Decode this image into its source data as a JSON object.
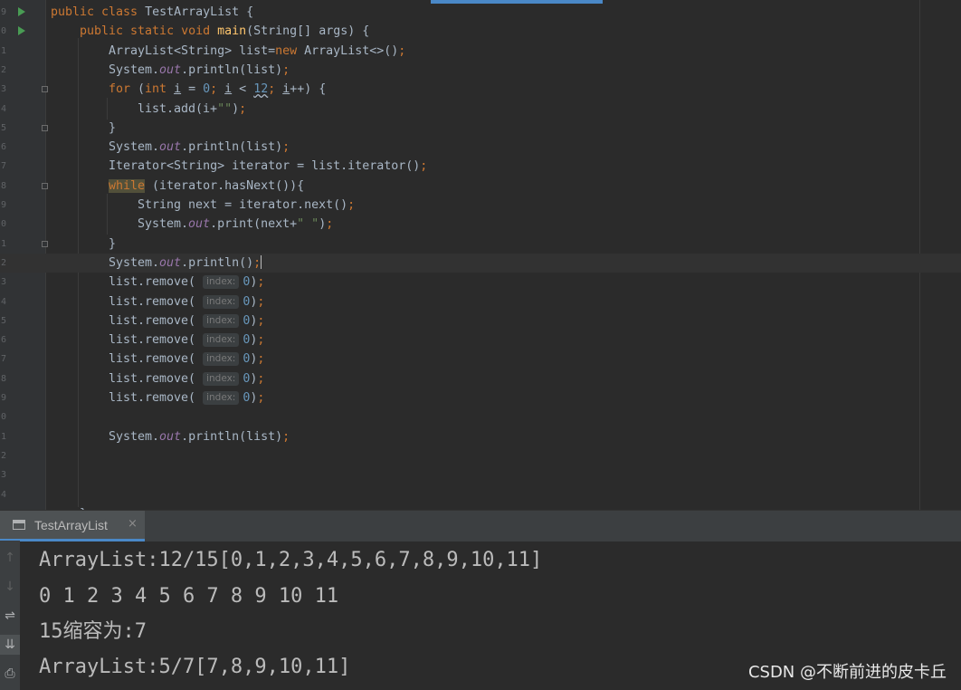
{
  "editor": {
    "lines": [
      {
        "num": "9",
        "run": true,
        "fold": false,
        "indent": 0,
        "current": false,
        "tokens": [
          {
            "t": "public class ",
            "c": "kw"
          },
          {
            "t": "TestArrayList {"
          }
        ]
      },
      {
        "num": "0",
        "run": true,
        "fold": false,
        "indent": 1,
        "current": false,
        "tokens": [
          {
            "t": "public static void ",
            "c": "kw"
          },
          {
            "t": "main",
            "c": "fn"
          },
          {
            "t": "(String[] args) {"
          }
        ]
      },
      {
        "num": "1",
        "run": false,
        "fold": false,
        "indent": 2,
        "current": false,
        "tokens": [
          {
            "t": "ArrayList<String> list="
          },
          {
            "t": "new ",
            "c": "kw"
          },
          {
            "t": "ArrayList<>()"
          },
          {
            "t": ";",
            "c": "kw"
          }
        ]
      },
      {
        "num": "2",
        "run": false,
        "fold": false,
        "indent": 2,
        "current": false,
        "tokens": [
          {
            "t": "System."
          },
          {
            "t": "out",
            "c": "fld"
          },
          {
            "t": ".println(list)"
          },
          {
            "t": ";",
            "c": "kw"
          }
        ]
      },
      {
        "num": "3",
        "run": false,
        "fold": true,
        "indent": 2,
        "current": false,
        "tokens": [
          {
            "t": "for ",
            "c": "kw"
          },
          {
            "t": "("
          },
          {
            "t": "int ",
            "c": "kw"
          },
          {
            "t": "i",
            "c": "und"
          },
          {
            "t": " = "
          },
          {
            "t": "0",
            "c": "num"
          },
          {
            "t": "; ",
            "c": "kw"
          },
          {
            "t": "i",
            "c": "und"
          },
          {
            "t": " < "
          },
          {
            "t": "12",
            "c": "num wavy"
          },
          {
            "t": "; ",
            "c": "kw"
          },
          {
            "t": "i",
            "c": "und"
          },
          {
            "t": "++) {"
          }
        ]
      },
      {
        "num": "4",
        "run": false,
        "fold": false,
        "indent": 3,
        "current": false,
        "tokens": [
          {
            "t": "list.add(i+"
          },
          {
            "t": "\"\"",
            "c": "str"
          },
          {
            "t": ")"
          },
          {
            "t": ";",
            "c": "kw"
          }
        ]
      },
      {
        "num": "5",
        "run": false,
        "fold": true,
        "indent": 2,
        "current": false,
        "tokens": [
          {
            "t": "}"
          }
        ]
      },
      {
        "num": "6",
        "run": false,
        "fold": false,
        "indent": 2,
        "current": false,
        "tokens": [
          {
            "t": "System."
          },
          {
            "t": "out",
            "c": "fld"
          },
          {
            "t": ".println(list)"
          },
          {
            "t": ";",
            "c": "kw"
          }
        ]
      },
      {
        "num": "7",
        "run": false,
        "fold": false,
        "indent": 2,
        "current": false,
        "tokens": [
          {
            "t": "Iterator<String> iterator = list.iterator()"
          },
          {
            "t": ";",
            "c": "kw"
          }
        ]
      },
      {
        "num": "8",
        "run": false,
        "fold": true,
        "indent": 2,
        "current": false,
        "tokens": [
          {
            "t": "while",
            "c": "kw hl"
          },
          {
            "t": " (iterator.hasNext()){"
          }
        ]
      },
      {
        "num": "9",
        "run": false,
        "fold": false,
        "indent": 3,
        "current": false,
        "tokens": [
          {
            "t": "String next = iterator.next()"
          },
          {
            "t": ";",
            "c": "kw"
          }
        ]
      },
      {
        "num": "0",
        "run": false,
        "fold": false,
        "indent": 3,
        "current": false,
        "tokens": [
          {
            "t": "System."
          },
          {
            "t": "out",
            "c": "fld"
          },
          {
            "t": ".print(next+"
          },
          {
            "t": "\" \"",
            "c": "str"
          },
          {
            "t": ")"
          },
          {
            "t": ";",
            "c": "kw"
          }
        ]
      },
      {
        "num": "1",
        "run": false,
        "fold": true,
        "indent": 2,
        "current": false,
        "tokens": [
          {
            "t": "}"
          }
        ]
      },
      {
        "num": "2",
        "run": false,
        "fold": false,
        "indent": 2,
        "current": true,
        "tokens": [
          {
            "t": "System."
          },
          {
            "t": "out",
            "c": "fld"
          },
          {
            "t": ".println()"
          },
          {
            "t": ";",
            "c": "kw"
          },
          {
            "t": "",
            "c": "caret"
          }
        ]
      },
      {
        "num": "3",
        "run": false,
        "fold": false,
        "indent": 2,
        "current": false,
        "tokens": [
          {
            "t": "list.remove( "
          },
          {
            "t": "index:",
            "c": "hint"
          },
          {
            "t": "0",
            "c": "num"
          },
          {
            "t": ")"
          },
          {
            "t": ";",
            "c": "kw"
          }
        ]
      },
      {
        "num": "4",
        "run": false,
        "fold": false,
        "indent": 2,
        "current": false,
        "tokens": [
          {
            "t": "list.remove( "
          },
          {
            "t": "index:",
            "c": "hint"
          },
          {
            "t": "0",
            "c": "num"
          },
          {
            "t": ")"
          },
          {
            "t": ";",
            "c": "kw"
          }
        ]
      },
      {
        "num": "5",
        "run": false,
        "fold": false,
        "indent": 2,
        "current": false,
        "tokens": [
          {
            "t": "list.remove( "
          },
          {
            "t": "index:",
            "c": "hint"
          },
          {
            "t": "0",
            "c": "num"
          },
          {
            "t": ")"
          },
          {
            "t": ";",
            "c": "kw"
          }
        ]
      },
      {
        "num": "6",
        "run": false,
        "fold": false,
        "indent": 2,
        "current": false,
        "tokens": [
          {
            "t": "list.remove( "
          },
          {
            "t": "index:",
            "c": "hint"
          },
          {
            "t": "0",
            "c": "num"
          },
          {
            "t": ")"
          },
          {
            "t": ";",
            "c": "kw"
          }
        ]
      },
      {
        "num": "7",
        "run": false,
        "fold": false,
        "indent": 2,
        "current": false,
        "tokens": [
          {
            "t": "list.remove( "
          },
          {
            "t": "index:",
            "c": "hint"
          },
          {
            "t": "0",
            "c": "num"
          },
          {
            "t": ")"
          },
          {
            "t": ";",
            "c": "kw"
          }
        ]
      },
      {
        "num": "8",
        "run": false,
        "fold": false,
        "indent": 2,
        "current": false,
        "tokens": [
          {
            "t": "list.remove( "
          },
          {
            "t": "index:",
            "c": "hint"
          },
          {
            "t": "0",
            "c": "num"
          },
          {
            "t": ")"
          },
          {
            "t": ";",
            "c": "kw"
          }
        ]
      },
      {
        "num": "9",
        "run": false,
        "fold": false,
        "indent": 2,
        "current": false,
        "tokens": [
          {
            "t": "list.remove( "
          },
          {
            "t": "index:",
            "c": "hint"
          },
          {
            "t": "0",
            "c": "num"
          },
          {
            "t": ")"
          },
          {
            "t": ";",
            "c": "kw"
          }
        ]
      },
      {
        "num": "0",
        "run": false,
        "fold": false,
        "indent": 2,
        "current": false,
        "tokens": []
      },
      {
        "num": "1",
        "run": false,
        "fold": false,
        "indent": 2,
        "current": false,
        "tokens": [
          {
            "t": "System."
          },
          {
            "t": "out",
            "c": "fld"
          },
          {
            "t": ".println(list)"
          },
          {
            "t": ";",
            "c": "kw"
          }
        ]
      },
      {
        "num": "2",
        "run": false,
        "fold": false,
        "indent": 2,
        "current": false,
        "tokens": []
      },
      {
        "num": "3",
        "run": false,
        "fold": false,
        "indent": 2,
        "current": false,
        "tokens": []
      },
      {
        "num": "4",
        "run": false,
        "fold": false,
        "indent": 2,
        "current": false,
        "tokens": []
      },
      {
        "num": "",
        "run": false,
        "fold": false,
        "indent": 1,
        "current": false,
        "tokens": [
          {
            "t": "}"
          }
        ]
      }
    ]
  },
  "run_panel": {
    "tab_label": "TestArrayList",
    "tab_close": "×",
    "toolbar": [
      {
        "name": "scroll-up-icon",
        "glyph": "↑",
        "dim": true,
        "active": false
      },
      {
        "name": "scroll-down-icon",
        "glyph": "↓",
        "dim": true,
        "active": false
      },
      {
        "name": "soft-wrap-icon",
        "glyph": "⇌",
        "dim": false,
        "active": false
      },
      {
        "name": "scroll-to-end-icon",
        "glyph": "⇊",
        "dim": false,
        "active": true
      },
      {
        "name": "print-icon",
        "glyph": "⎙",
        "dim": false,
        "active": false
      }
    ],
    "output": [
      "ArrayList:12/15[0,1,2,3,4,5,6,7,8,9,10,11]",
      "0 1 2 3 4 5 6 7 8 9 10 11",
      "15缩容为:7",
      "ArrayList:5/7[7,8,9,10,11]"
    ]
  },
  "watermark": "CSDN @不断前进的皮卡丘"
}
